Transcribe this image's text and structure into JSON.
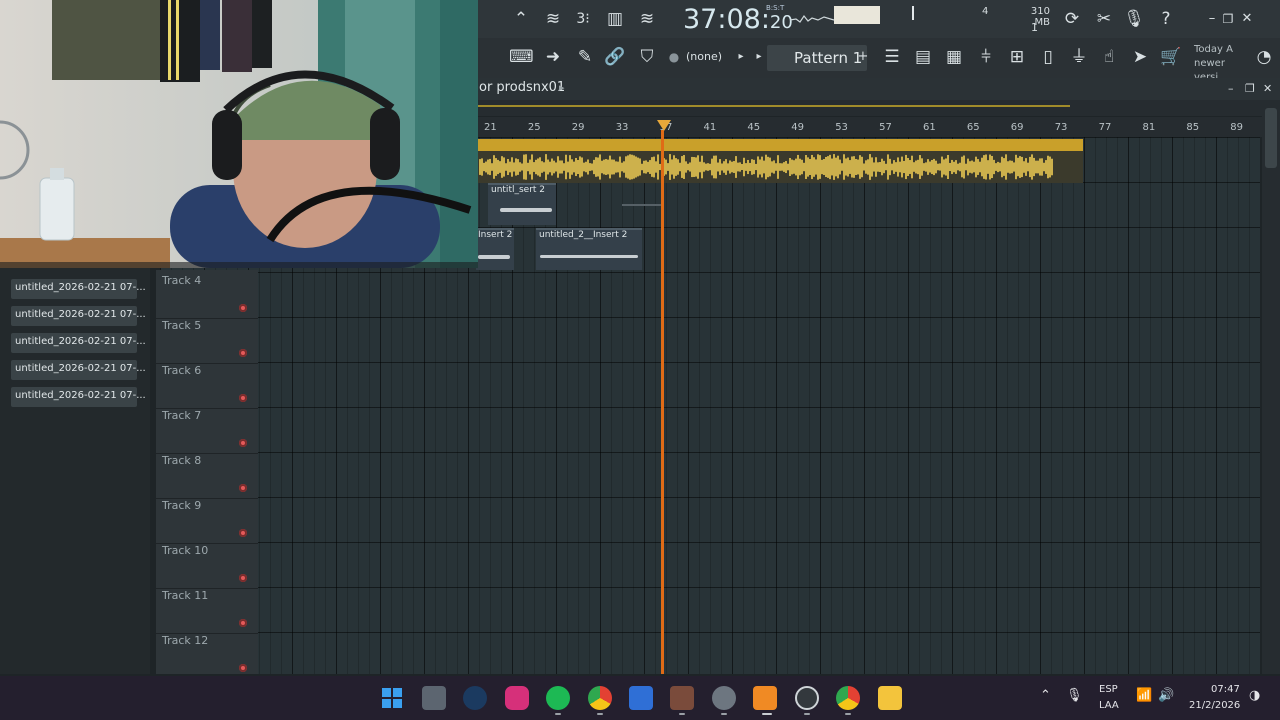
{
  "toolbar": {
    "time_main": "37:08",
    "time_small": "20",
    "time_unit": "B:S:T",
    "cpu_value": "4",
    "memory": "310 MB",
    "polyphony": "1",
    "pattern_selector": "(none)",
    "pattern_name": "Pattern 1",
    "hint_text": "Today  A newer versi..."
  },
  "playlist": {
    "title": "or prodsnx01",
    "ruler_ticks": [
      "21",
      "25",
      "29",
      "33",
      "37",
      "41",
      "45",
      "49",
      "53",
      "57",
      "61",
      "65",
      "69",
      "73",
      "77",
      "81",
      "85",
      "89"
    ],
    "clips": {
      "track2_clip": "untitl_sert 2",
      "track3_clip_a": "Insert 2",
      "track3_clip_b": "untitled_2__Insert 2"
    },
    "tracks": [
      "Track 4",
      "Track 5",
      "Track 6",
      "Track 7",
      "Track 8",
      "Track 9",
      "Track 10",
      "Track 11",
      "Track 12"
    ]
  },
  "browser": {
    "items": [
      "untitled_2026-02-21 07-...",
      "untitled_2026-02-21 07-...",
      "untitled_2026-02-21 07-...",
      "untitled_2026-02-21 07-...",
      "untitled_2026-02-21 07-..."
    ]
  },
  "taskbar": {
    "icons": [
      "windows-start",
      "camera-app",
      "steam",
      "instagram",
      "spotify",
      "chrome",
      "microsoft-store",
      "game-thumbnail",
      "settings",
      "fl-studio",
      "obs",
      "chrome-2",
      "file-explorer"
    ],
    "language": "ESP",
    "layout": "LAA",
    "time": "07:47",
    "date": "21/2/2026"
  },
  "colors": {
    "accent_orange": "#e06b16",
    "clip_gold": "#c9a02a",
    "waveform": "#f2cf55"
  }
}
